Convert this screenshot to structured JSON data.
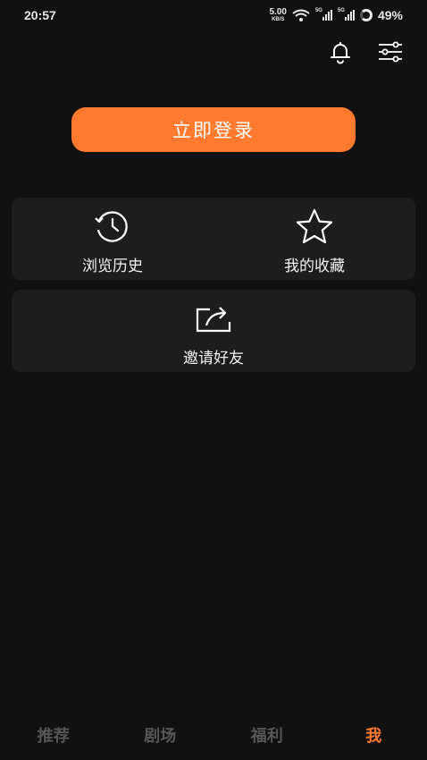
{
  "status": {
    "time": "20:57",
    "net_speed": "5.00",
    "net_unit": "KB/S",
    "sig1_tag": "5G",
    "sig2_tag": "5G",
    "battery": "49%"
  },
  "header": {
    "bell_icon": "bell-icon",
    "settings_icon": "sliders-icon"
  },
  "login": {
    "label": "立即登录"
  },
  "shortcuts": [
    {
      "label": "浏览历史",
      "icon": "history-clock-icon"
    },
    {
      "label": "我的收藏",
      "icon": "star-icon"
    }
  ],
  "invite": {
    "label": "邀请好友",
    "icon": "share-icon"
  },
  "tabs": [
    {
      "label": "推荐",
      "active": false
    },
    {
      "label": "剧场",
      "active": false
    },
    {
      "label": "福利",
      "active": false
    },
    {
      "label": "我",
      "active": true
    }
  ],
  "colors": {
    "accent": "#ff7a2f",
    "background": "#111111",
    "card": "#1d1d1d"
  }
}
